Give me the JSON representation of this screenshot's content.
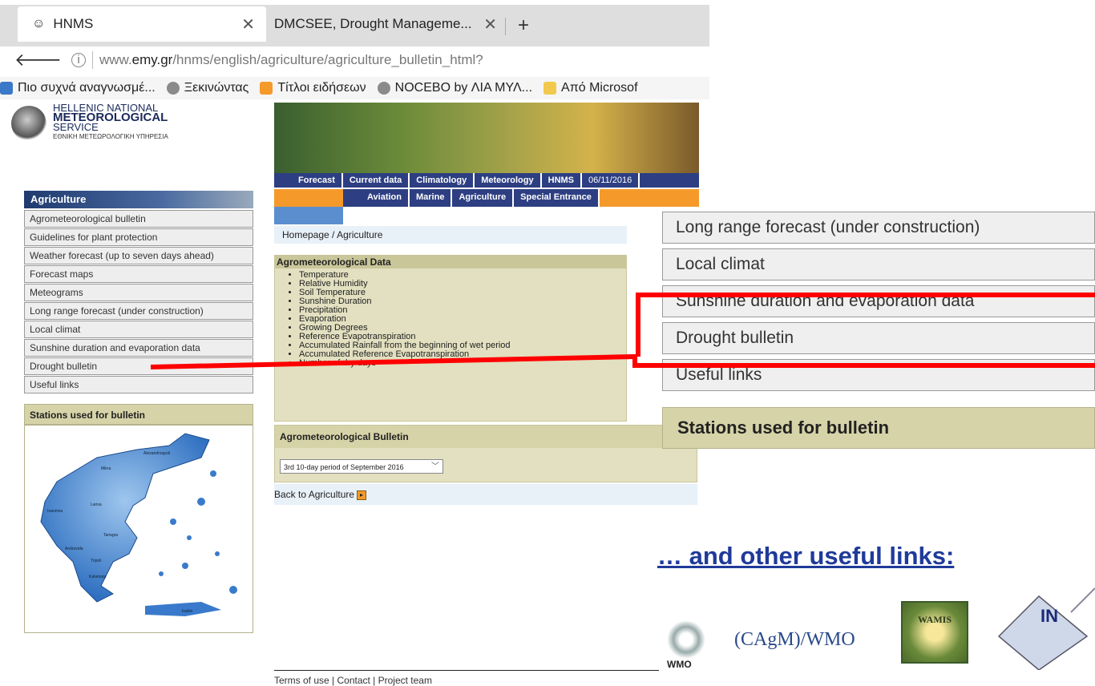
{
  "browser": {
    "tabs": [
      {
        "title": "HNMS"
      },
      {
        "title": "DMCSEE, Drought Manageme..."
      }
    ],
    "url_prefix": "www.",
    "url_domain": "emy.gr",
    "url_path": "/hnms/english/agriculture/agriculture_bulletin_html?",
    "bookmarks": [
      {
        "label": "Πιο συχνά αναγνωσμέ...",
        "icon": "most-visited-icon"
      },
      {
        "label": "Ξεκινώντας",
        "icon": "globe-icon"
      },
      {
        "label": "Τίτλοι ειδήσεων",
        "icon": "rss-icon"
      },
      {
        "label": "NOCEBO by ΛΙΑ ΜΥΛ...",
        "icon": "globe-icon"
      },
      {
        "label": "Από Microsof",
        "icon": "folder-icon"
      }
    ]
  },
  "logo": {
    "line1": "HELLENIC NATIONAL",
    "line2": "METEOROLOGICAL",
    "line3": "SERVICE",
    "line4": "ΕΘΝΙΚΗ ΜΕΤΕΩΡΟΛΟΓΙΚΗ ΥΠΗΡΕΣΙΑ"
  },
  "nav_top": [
    "Forecast",
    "Current data",
    "Climatology",
    "Meteorology",
    "HNMS"
  ],
  "date": "06/11/2016",
  "nav_sub": [
    "Aviation",
    "Marine",
    "Agriculture",
    "Special Entrance"
  ],
  "sidebar": {
    "heading": "Agriculture",
    "items": [
      "Agrometeorological bulletin",
      "Guidelines for plant protection",
      "Weather forecast (up to seven days ahead)",
      "Forecast maps",
      "Meteograms",
      "Long range forecast (under construction)",
      "Local climat",
      "Sunshine duration and evaporation data",
      "Drought bulletin",
      "Useful links"
    ],
    "stations_heading": "Stations used for bulletin",
    "map_labels": [
      "Alexandroupoli",
      "Mikra",
      "Larisa",
      "Ioannina",
      "Tanagra",
      "Andravida",
      "Tripoli",
      "Kalamata",
      "Iraklio"
    ]
  },
  "breadcrumb": {
    "home": "Homepage",
    "sep": " / ",
    "current": "Agriculture"
  },
  "agro_data": {
    "heading": "Agrometeorological Data",
    "items": [
      "Temperature",
      "Relative Humidity",
      "Soil Temperature",
      "Sunshine Duration",
      "Precipitation",
      "Evaporation",
      "Growing Degrees",
      "Reference Evapotranspiration",
      "Accumulated Rainfall from the beginning of wet period",
      "Accumulated Reference Evapotranspiration",
      "Number of dry days"
    ]
  },
  "bulletin": {
    "heading": "Agrometeorological Bulletin",
    "selected": "3rd 10-day period of September 2016"
  },
  "back_link": "Back to Agriculture",
  "footer": "Terms of use | Contact | Project team",
  "zoom": {
    "items": [
      "Long range forecast (under construction)",
      "Local climat",
      "Sunshine duration and evaporation data",
      "Drought bulletin",
      "Useful links"
    ],
    "stations_heading": "Stations used for bulletin"
  },
  "other_links": {
    "prefix": "…",
    "text": " and other useful links:"
  },
  "logos": {
    "wmo_short": "WMO",
    "wmo_text": "(CAgM)/WMO",
    "wamis_text": "WAMIS",
    "in_text": "IN"
  },
  "colors": {
    "highlight": "#ff0000",
    "nav_blue": "#2d3f82",
    "nav_orange": "#f59a2a",
    "panel_olive": "#e2e0c0",
    "link_blue": "#1f3a9a"
  }
}
